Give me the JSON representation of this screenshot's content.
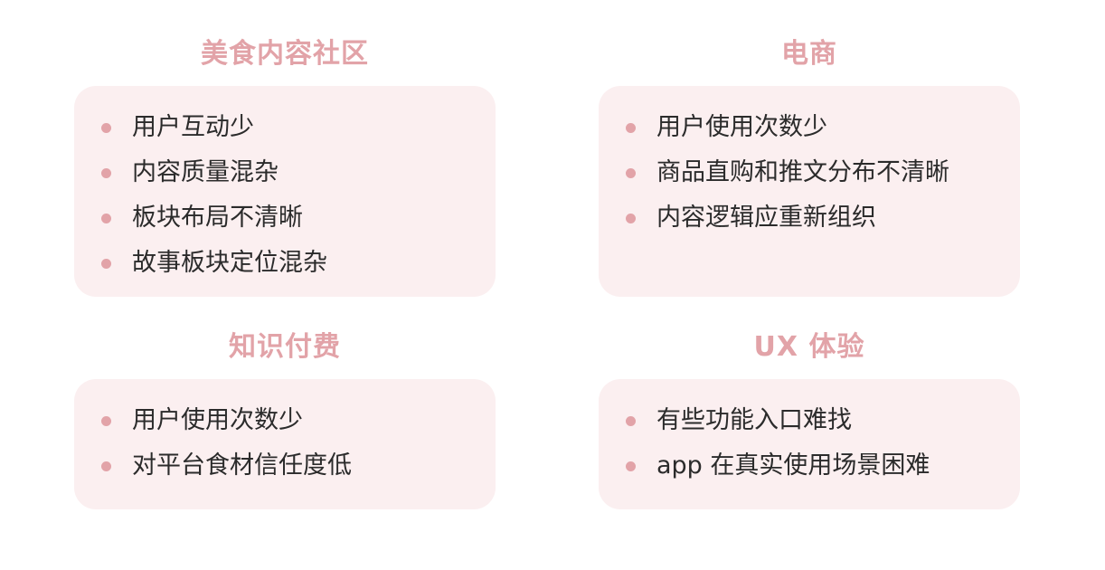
{
  "sections": [
    {
      "title": "美食内容社区",
      "items": [
        "用户互动少",
        "内容质量混杂",
        "板块布局不清晰",
        "故事板块定位混杂"
      ]
    },
    {
      "title": "电商",
      "items": [
        "用户使用次数少",
        "商品直购和推文分布不清晰",
        "内容逻辑应重新组织"
      ]
    },
    {
      "title": "知识付费",
      "items": [
        "用户使用次数少",
        "对平台食材信任度低"
      ]
    },
    {
      "title": "UX 体验",
      "items": [
        "有些功能入口难找",
        "app 在真实使用场景困难"
      ]
    }
  ],
  "colors": {
    "accent": "#e2a3a8",
    "card_background": "#fbeff0",
    "text": "#2b2b2b"
  },
  "icons": {
    "bullet": "bullet-dot-icon"
  }
}
